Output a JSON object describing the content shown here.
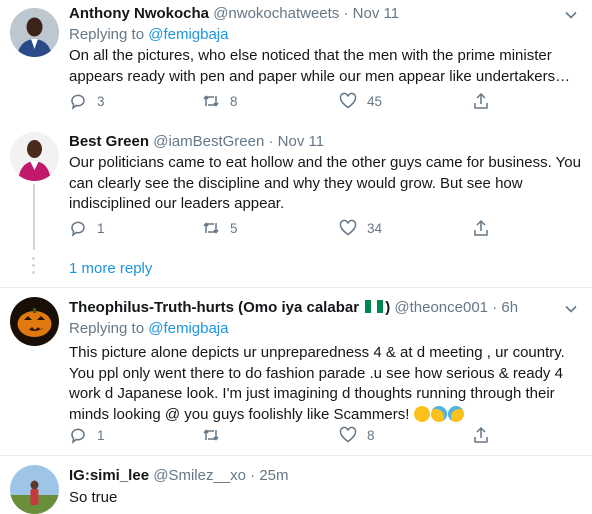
{
  "tweets": [
    {
      "name": "Anthony Nwokocha",
      "handle": "@nwokochatweets",
      "separator": "·",
      "time": "Nov 11",
      "replying_label": "Replying to",
      "replying_mention": "@femigbaja",
      "text": "On all the pictures, who else noticed that the men with the prime minister appears ready with pen and paper while our men appear like undertakers…",
      "replies": "3",
      "retweets": "8",
      "likes": "45"
    },
    {
      "name": "Best Green",
      "handle": "@iamBestGreen",
      "separator": "·",
      "time": "Nov 11",
      "text": "Our politicians came to eat hollow and the other guys came for business. You can clearly see the discipline and why they would grow. But see how indisciplined our leaders appear.",
      "replies": "1",
      "retweets": "5",
      "likes": "34"
    },
    {
      "name": "Theophilus-Truth-hurts (Omo iya calabar",
      "name_end": ")",
      "handle": "@theonce001",
      "separator": "·",
      "time": "6h",
      "replying_label": "Replying to",
      "replying_mention": "@femigbaja",
      "text": "This picture alone depicts ur unpreparedness 4 & at d meeting , ur country. You ppl only went there to do fashion parade .u see how serious & ready 4 work d Japanese look. I'm just imagining d thoughts running through their minds looking @ you guys foolishly like Scammers!",
      "replies": "1",
      "retweets": "",
      "likes": "8"
    },
    {
      "name": "IG:simi_lee",
      "handle": "@Smilez__xo",
      "separator": "·",
      "time": "25m",
      "text": "So true"
    }
  ],
  "more_replies": "1 more reply",
  "colors": {
    "link": "#1b95e0",
    "muted": "#657786",
    "divider": "#e6ecf0"
  },
  "icons": [
    "reply-icon",
    "retweet-icon",
    "like-icon",
    "share-icon",
    "chevron-down-icon"
  ]
}
